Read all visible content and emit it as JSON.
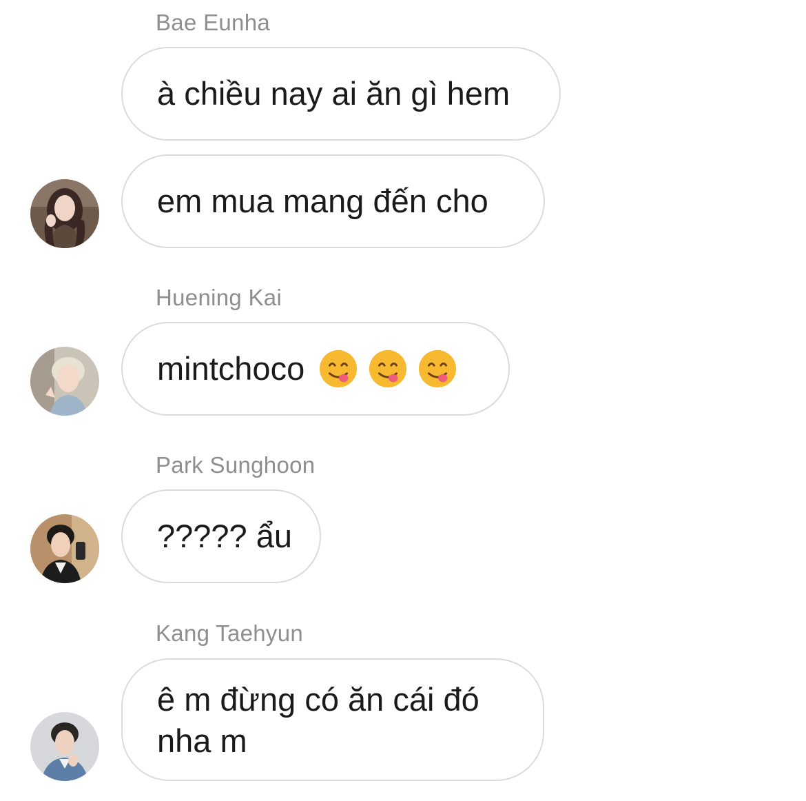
{
  "messages": [
    {
      "sender": "Bae Eunha",
      "bubbles": [
        "à chiều nay ai ăn gì hem",
        "em mua mang đến cho"
      ]
    },
    {
      "sender": "Huening Kai",
      "bubbles": [
        "mintchoco"
      ],
      "emojis": [
        "yum-face-emoji",
        "yum-face-emoji",
        "yum-face-emoji"
      ]
    },
    {
      "sender": "Park Sunghoon",
      "bubbles": [
        "????? ẩu"
      ]
    },
    {
      "sender": "Kang Taehyun",
      "bubbles": [
        "ê m đừng có ăn cái đó nha m"
      ]
    }
  ],
  "colors": {
    "bubble_border": "#dbdbdb",
    "sender_name": "#8e8e8e",
    "message_text": "#1a1a1a",
    "emoji_face": "#f7b92f",
    "emoji_tongue": "#ee5c7c"
  }
}
